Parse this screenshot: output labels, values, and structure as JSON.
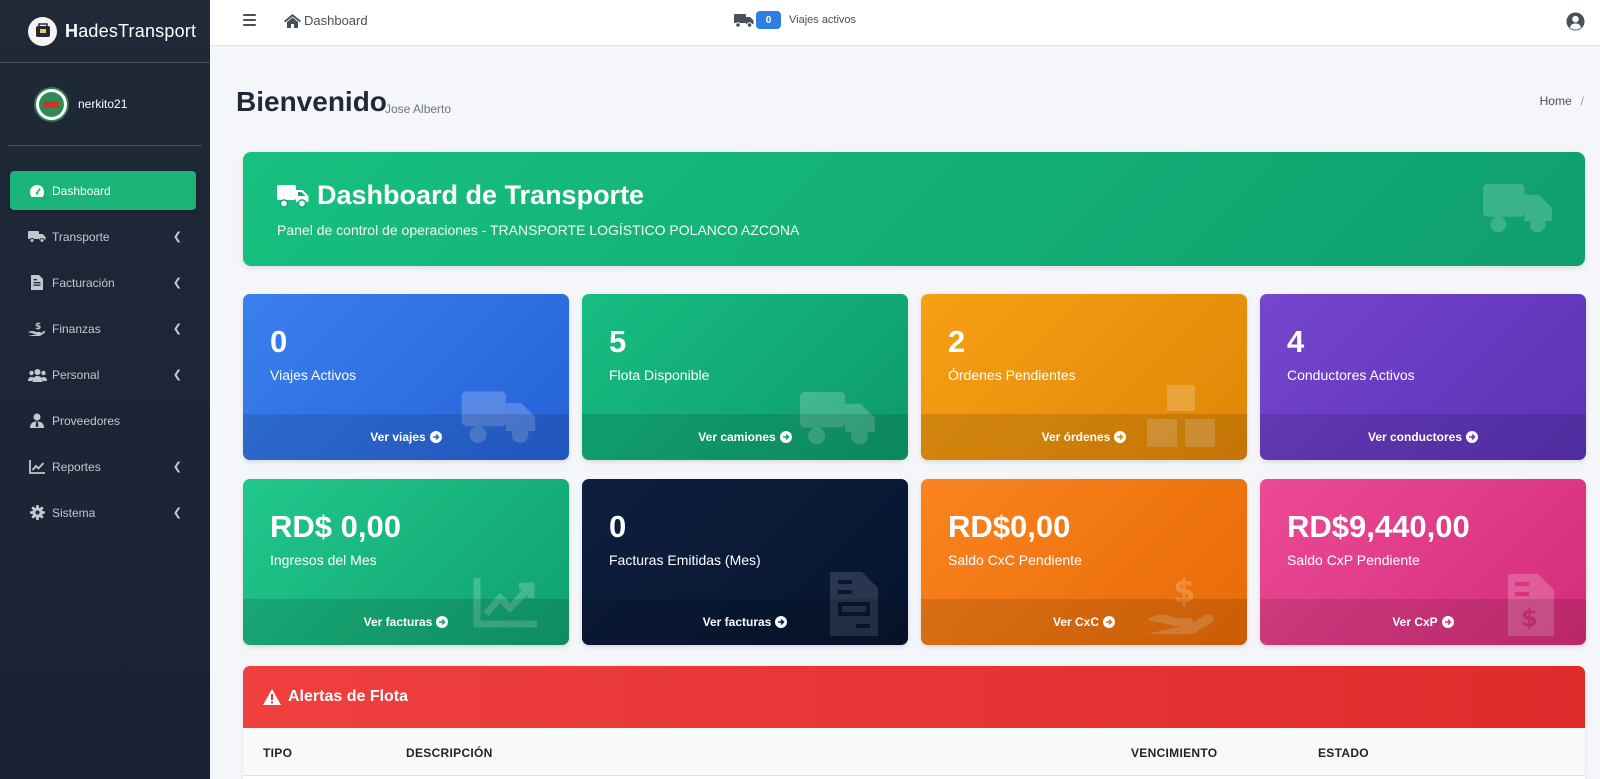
{
  "brand": {
    "bold": "H",
    "rest": "adesTransport"
  },
  "user": {
    "name": "nerkito21"
  },
  "sidebar": {
    "items": [
      {
        "label": "Dashboard",
        "icon": "gauge-icon",
        "active": true,
        "has_arrow": false
      },
      {
        "label": "Transporte",
        "icon": "truck-icon",
        "active": false,
        "has_arrow": true
      },
      {
        "label": "Facturación",
        "icon": "invoice-icon",
        "active": false,
        "has_arrow": true
      },
      {
        "label": "Finanzas",
        "icon": "hand-money-icon",
        "active": false,
        "has_arrow": true
      },
      {
        "label": "Personal",
        "icon": "users-icon",
        "active": false,
        "has_arrow": true
      },
      {
        "label": "Proveedores",
        "icon": "user-tie-icon",
        "active": false,
        "has_arrow": false
      },
      {
        "label": "Reportes",
        "icon": "chart-line-icon",
        "active": false,
        "has_arrow": true
      },
      {
        "label": "Sistema",
        "icon": "gear-icon",
        "active": false,
        "has_arrow": true
      }
    ]
  },
  "topbar": {
    "home_label": "Dashboard",
    "viajes_count": "0",
    "viajes_label": "Viajes activos"
  },
  "page": {
    "title": "Bienvenido",
    "subtitle": "Jose Alberto",
    "breadcrumb": "Home",
    "breadcrumb_sep": "/"
  },
  "hero": {
    "title": "Dashboard de Transporte",
    "subtitle": "Panel de control de operaciones - TRANSPORTE LOGÍSTICO POLANCO AZCONA"
  },
  "cards": [
    {
      "value": "0",
      "label": "Viajes Activos",
      "link": "Ver viajes",
      "color": "#2f6fe4",
      "icon": "truck-icon"
    },
    {
      "value": "5",
      "label": "Flota Disponible",
      "link": "Ver camiones",
      "color": "#14ad76",
      "icon": "truck-icon"
    },
    {
      "value": "2",
      "label": "Órdenes Pendientes",
      "link": "Ver órdenes",
      "color": "#ef960d",
      "icon": "boxes-icon"
    },
    {
      "value": "4",
      "label": "Conductores Activos",
      "link": "Ver conductores",
      "color": "#683cc2",
      "icon": "users-icon"
    },
    {
      "value": "RD$ 0,00",
      "label": "Ingresos del Mes",
      "link": "Ver facturas",
      "color": "#18b47d",
      "icon": "chart-line-icon"
    },
    {
      "value": "0",
      "label": "Facturas Emitidas (Mes)",
      "link": "Ver facturas",
      "color": "#0a1a36",
      "icon": "invoice-icon"
    },
    {
      "value": "RD$0,00",
      "label": "Saldo CxC Pendiente",
      "link": "Ver CxC",
      "color": "#f27713",
      "icon": "hand-money-icon"
    },
    {
      "value": "RD$9,440,00",
      "label": "Saldo CxP Pendiente",
      "link": "Ver CxP",
      "color": "#e13b88",
      "icon": "invoice-dollar-icon"
    }
  ],
  "alerts": {
    "title": "Alertas de Flota",
    "columns": [
      "TIPO",
      "DESCRIPCIÓN",
      "VENCIMIENTO",
      "ESTADO"
    ]
  }
}
